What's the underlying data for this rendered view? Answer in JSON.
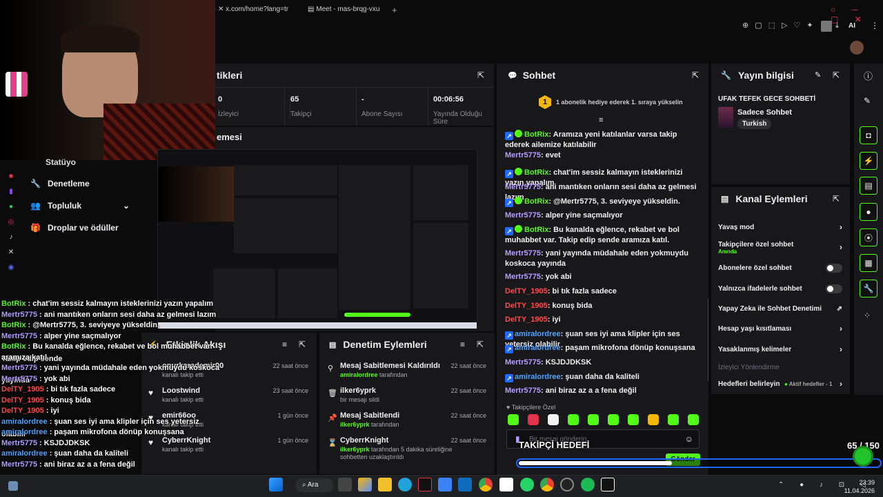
{
  "browser": {
    "tab1": "x.com/home?lang=tr",
    "tab2": "Meet - mas-brqg-vxu",
    "ai": "AI"
  },
  "left_nav": {
    "item_partial": "Statüyo",
    "moderation": "Denetleme",
    "community": "Topluluk",
    "drops": "Droplar ve ödüller"
  },
  "stats": {
    "title": "tikleri",
    "items": [
      {
        "value": "0",
        "label": "İzleyici"
      },
      {
        "value": "65",
        "label": "Takipçi"
      },
      {
        "value": "-",
        "label": "Abone Sayısı"
      },
      {
        "value": "00:06:56",
        "label": "Yayında Olduğu Süre"
      }
    ]
  },
  "preview": {
    "title": "emesi"
  },
  "chat": {
    "title": "Sohbet",
    "gift_count": "1",
    "gift_text": "1 abonelik hediye ederek 1. sıraya yükselin",
    "placeholder": "Bir mesaj gönderin",
    "send": "Gönder",
    "goal_label": "Takipçilere Özel",
    "messages": [
      {
        "user": "BotRix",
        "color": "#53fc18",
        "bot": true,
        "text": ": Aramıza yeni katılanlar varsa takip ederek ailemize katılabilir"
      },
      {
        "user": "Mertr5775",
        "color": "#b59cff",
        "bot": false,
        "text": ": evet"
      },
      {
        "user": "BotRix",
        "color": "#53fc18",
        "bot": true,
        "text": ": chat'im sessiz kalmayın isteklerinizi yazın yapalım"
      },
      {
        "user": "Mertr5775",
        "color": "#b59cff",
        "bot": false,
        "text": ": ani mantıken onların sesi daha az gelmesi lazım"
      },
      {
        "user": "BotRix",
        "color": "#53fc18",
        "bot": true,
        "text": ": @Mertr5775, 3. seviyeye yükseldin."
      },
      {
        "user": "Mertr5775",
        "color": "#b59cff",
        "bot": false,
        "text": ": alper yine saçmalıyor"
      },
      {
        "user": "BotRix",
        "color": "#53fc18",
        "bot": true,
        "text": ": Bu kanalda eğlence, rekabet ve bol muhabbet var. Takip edip sende aramıza katıl."
      },
      {
        "user": "Mertr5775",
        "color": "#b59cff",
        "bot": false,
        "text": ": yani yayında müdahale eden yokmuydu koskoca yayında"
      },
      {
        "user": "Mertr5775",
        "color": "#b59cff",
        "bot": false,
        "text": ": yok abi"
      },
      {
        "user": "DelTY_1905",
        "color": "#ff4b4b",
        "bot": false,
        "text": ": bi tık fazla sadece"
      },
      {
        "user": "DelTY_1905",
        "color": "#ff4b4b",
        "bot": false,
        "text": ": konuş bida"
      },
      {
        "user": "DelTY_1905",
        "color": "#ff4b4b",
        "bot": false,
        "text": ": iyi"
      },
      {
        "user": "amiralordree",
        "color": "#4ea3ff",
        "bot": false,
        "text": ": şuan ses iyi ama klipler için ses yetersiz olabilir"
      },
      {
        "user": "amiralordree",
        "color": "#4ea3ff",
        "bot": false,
        "text": ": paşam mikrofona dönüp konuşsana"
      },
      {
        "user": "Mertr5775",
        "color": "#b59cff",
        "bot": false,
        "text": ": KSJDJDKSK"
      },
      {
        "user": "amiralordree",
        "color": "#4ea3ff",
        "bot": false,
        "text": ": şuan daha da kaliteli"
      },
      {
        "user": "Mertr5775",
        "color": "#b59cff",
        "bot": false,
        "text": ": ani biraz az a a fena değil"
      }
    ]
  },
  "stream_info": {
    "title": "Yayın bilgisi",
    "stream_title": "UFAK TEFEK GECE SOHBETİ",
    "category": "Sadece Sohbet",
    "language": "Turkish"
  },
  "channel_actions": {
    "title": "Kanal Eylemleri",
    "slow": "Yavaş mod",
    "followers": "Takipçilere özel sohbet",
    "followers_sub": "Anında",
    "subs": "Abonelere özel sohbet",
    "emotes": "Yalnızca ifadelerle sohbet",
    "ai_mod": "Yapay Zeka ile Sohbet Denetimi",
    "age": "Hesap yaşı kısıtlaması",
    "banned": "Yasaklanmış kelimeler",
    "viewer_header": "İzleyici Yönlendirme",
    "goals": "Hedefleri belirleyin",
    "goals_sub": "Aktif hedefler - 1"
  },
  "activity": {
    "title": "Etkinlik Akışı",
    "items": [
      {
        "name": "onurkarademir00",
        "sub": "kanalı takip etti",
        "time": "22 saat önce"
      },
      {
        "name": "Loostwind",
        "sub": "kanalı takip etti",
        "time": "23 saat önce"
      },
      {
        "name": "emir66oo",
        "sub": "kanalı takip etti",
        "time": "1 gün önce"
      },
      {
        "name": "CyberrKnight",
        "sub": "kanalı takip etti",
        "time": "1 gün önce"
      }
    ]
  },
  "mod_actions": {
    "title": "Denetim Eylemleri",
    "items": [
      {
        "title": "Mesaj Sabitlemesi Kaldırıldı",
        "sub": "amiralordree",
        "sub2": " tarafından",
        "time": "22 saat önce"
      },
      {
        "title": "ilker6yprk",
        "sub": "",
        "sub2": "bir mesajı sildi",
        "time": "22 saat önce"
      },
      {
        "title": "Mesaj Sabitlendi",
        "sub": "ilker6yprk",
        "sub2": " tarafından",
        "time": "22 saat önce"
      },
      {
        "title": "CyberrKnight",
        "sub": "ilker6yprk",
        "sub2": " tarafından 5 dakika süreliğine sohbetten uzaklaştırıldı",
        "time": "22 saat önce"
      }
    ]
  },
  "overlay": {
    "goal_title": "TAKİPÇİ HEDEFİ",
    "goal_count": "65 / 150",
    "goal_progress": 0.43,
    "chat": [
      {
        "user": "BotRix",
        "color": "#53fc18",
        "text": " : chat'im sessiz kalmayın isteklerinizi yazın yapalım"
      },
      {
        "user": "Mertr5775",
        "color": "#b59cff",
        "text": " : ani mantıken onların sesi daha az gelmesi lazım"
      },
      {
        "user": "BotRix",
        "color": "#53fc18",
        "text": " : @Mertr5775, 3. seviyeye yükseldin."
      },
      {
        "user": "Mertr5775",
        "color": "#b59cff",
        "text": " : alper yine saçmalıyor"
      },
      {
        "user": "BotRix",
        "color": "#53fc18",
        "text": " : Bu kanalda eğlence, rekabet ve bol muhabbet var. Takip edip sende"
      },
      {
        "user": "",
        "color": "#fff",
        "text": "aramıza katıl."
      },
      {
        "user": "Mertr5775",
        "color": "#b59cff",
        "text": " : yani yayında müdahale eden yokmuydu koskoca yayında"
      },
      {
        "user": "Mertr5775",
        "color": "#b59cff",
        "text": " : yok abi"
      },
      {
        "user": "DelTY_1905",
        "color": "#ff4b4b",
        "text": " : bi tık fazla sadece"
      },
      {
        "user": "DelTY_1905",
        "color": "#ff4b4b",
        "text": " : konuş bida"
      },
      {
        "user": "DelTY_1905",
        "color": "#ff4b4b",
        "text": " : iyi"
      },
      {
        "user": "amiralordree",
        "color": "#4ea3ff",
        "text": " : şuan ses iyi ama klipler için ses yetersiz olabilir"
      },
      {
        "user": "amiralordree",
        "color": "#4ea3ff",
        "text": " : paşam mikrofona dönüp konuşsana"
      },
      {
        "user": "Mertr5775",
        "color": "#b59cff",
        "text": " : KSJDJDKSK"
      },
      {
        "user": "amiralordree",
        "color": "#4ea3ff",
        "text": " : şuan daha da kaliteli"
      },
      {
        "user": "Mertr5775",
        "color": "#b59cff",
        "text": " : ani biraz az a a fena değil"
      }
    ]
  },
  "taskbar": {
    "search": "Ara",
    "time": "23:39",
    "date": "11.04.2026"
  },
  "colors": {
    "accent": "#53fc18",
    "panel": "#18181b"
  }
}
